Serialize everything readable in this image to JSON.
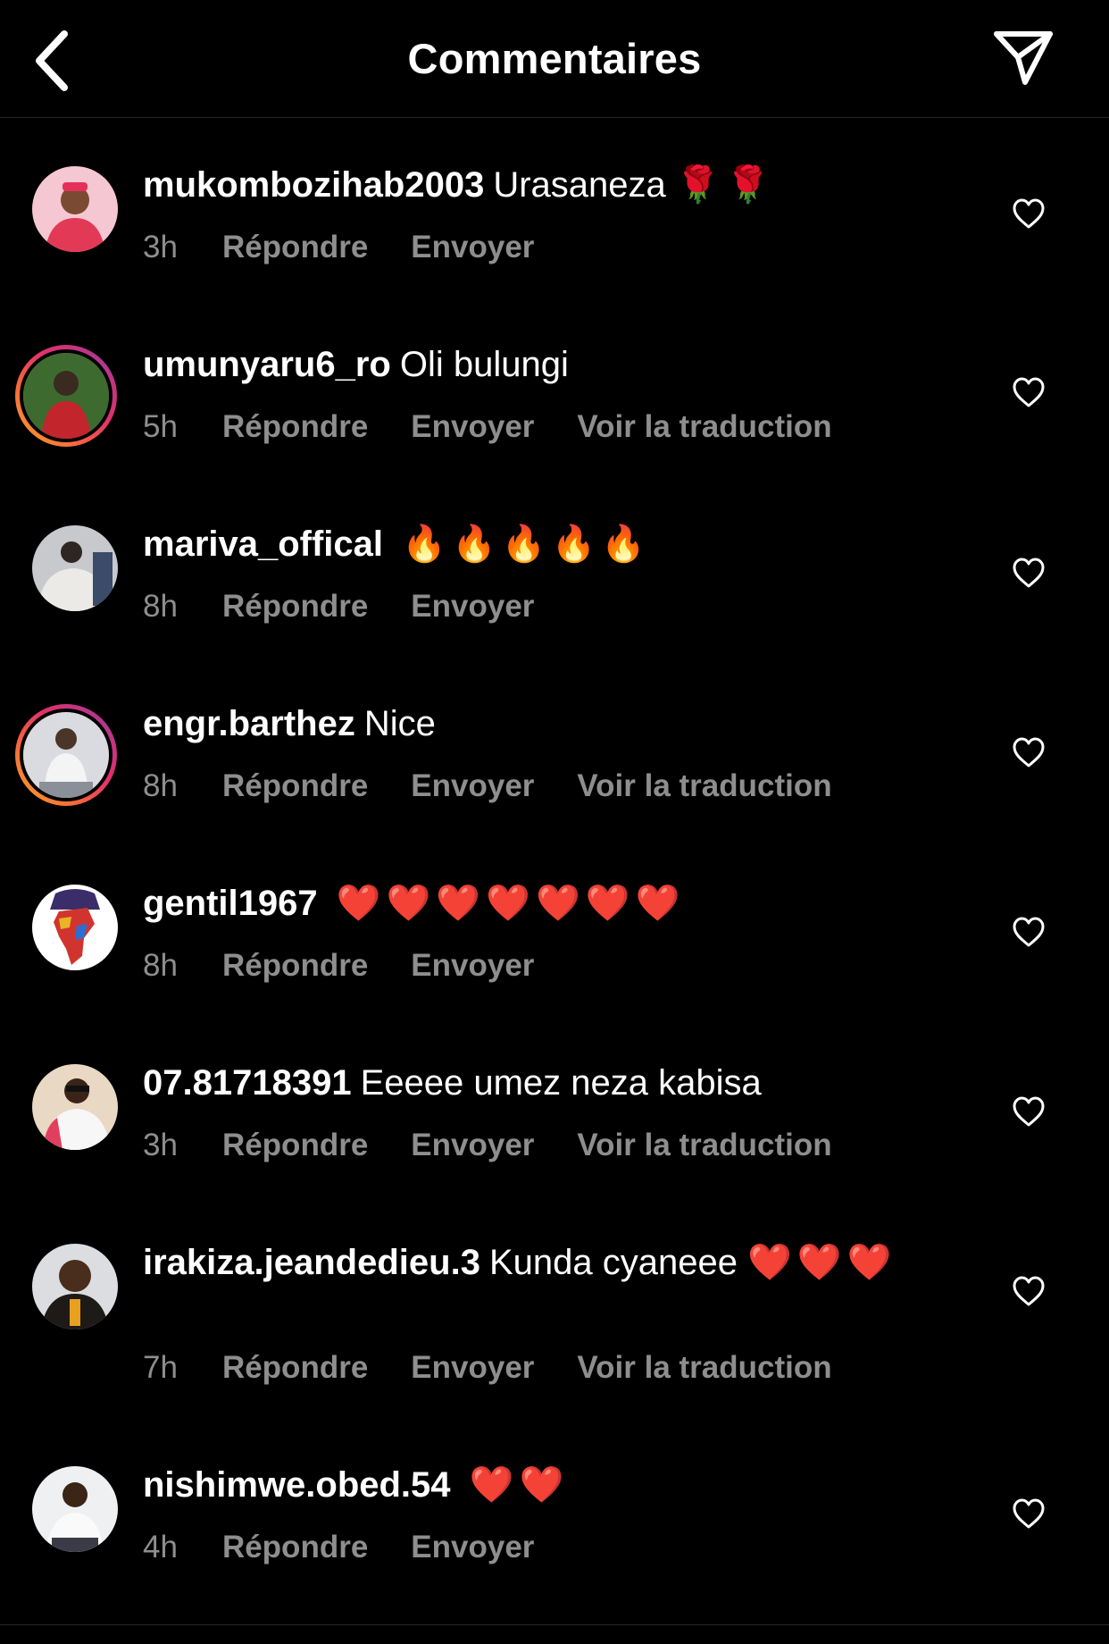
{
  "header": {
    "title": "Commentaires"
  },
  "actions": {
    "reply": "Répondre",
    "send": "Envoyer",
    "translate": "Voir la traduction"
  },
  "comments": [
    {
      "username": "mukombozihab2003",
      "text": "Urasaneza",
      "emoji": "🌹🌹",
      "time": "3h",
      "translation": false,
      "story_ring": false
    },
    {
      "username": "umunyaru6_ro",
      "text": "Oli bulungi",
      "emoji": "",
      "time": "5h",
      "translation": true,
      "story_ring": true
    },
    {
      "username": "mariva_offical",
      "text": "",
      "emoji": "🔥🔥🔥🔥🔥",
      "time": "8h",
      "translation": false,
      "story_ring": false
    },
    {
      "username": "engr.barthez",
      "text": "Nice",
      "emoji": "",
      "time": "8h",
      "translation": true,
      "story_ring": true
    },
    {
      "username": "gentil1967",
      "text": "",
      "emoji": "❤️❤️❤️❤️❤️❤️❤️",
      "time": "8h",
      "translation": false,
      "story_ring": false
    },
    {
      "username": "07.81718391",
      "text": "Eeeee umez neza kabisa",
      "emoji": "",
      "time": "3h",
      "translation": true,
      "story_ring": false
    },
    {
      "username": "irakiza.jeandedieu.3",
      "text": "Kunda cyaneee",
      "emoji": "❤️❤️❤️",
      "time": "7h",
      "translation": true,
      "story_ring": false
    },
    {
      "username": "nishimwe.obed.54",
      "text": "",
      "emoji": "❤️❤️",
      "time": "4h",
      "translation": false,
      "story_ring": false
    }
  ],
  "icons": {
    "back": "chevron-left-icon",
    "share": "paper-plane-icon",
    "like": "heart-outline-icon"
  },
  "colors": {
    "background": "#000000",
    "secondary_text": "#8e8e8e",
    "story_ring": [
      "#f9a825",
      "#e1306c",
      "#833ab4"
    ]
  }
}
